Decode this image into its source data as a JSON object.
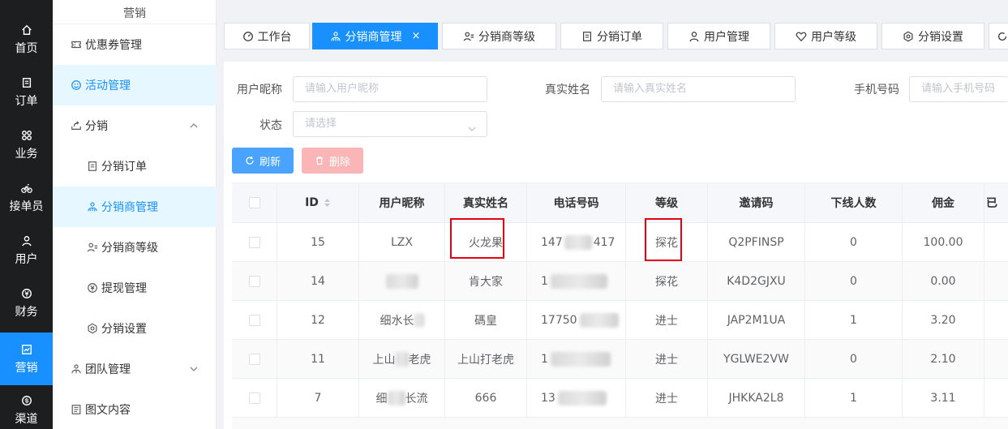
{
  "rail": {
    "items": [
      {
        "label": "首页",
        "icon": "home-icon"
      },
      {
        "label": "订单",
        "icon": "order-icon"
      },
      {
        "label": "业务",
        "icon": "business-icon"
      },
      {
        "label": "接单员",
        "icon": "bike-icon"
      },
      {
        "label": "用户",
        "icon": "user-icon"
      },
      {
        "label": "财务",
        "icon": "finance-icon"
      },
      {
        "label": "营销",
        "icon": "marketing-icon"
      },
      {
        "label": "渠道",
        "icon": "channel-icon"
      }
    ],
    "active_index": 6,
    "accent": "#1890ff"
  },
  "submenu": {
    "header": "营销",
    "items": [
      {
        "label": "优惠券管理",
        "icon": "coupon-icon"
      },
      {
        "label": "活动管理",
        "icon": "smile-icon"
      },
      {
        "label": "分销",
        "icon": "share-icon"
      },
      {
        "label": "分销订单",
        "icon": "document-icon"
      },
      {
        "label": "分销商管理",
        "icon": "distributor-icon"
      },
      {
        "label": "分销商等级",
        "icon": "user-list-icon"
      },
      {
        "label": "提现管理",
        "icon": "withdraw-icon"
      },
      {
        "label": "分销设置",
        "icon": "settings-icon"
      },
      {
        "label": "团队管理",
        "icon": "team-icon"
      },
      {
        "label": "图文内容",
        "icon": "article-icon"
      }
    ]
  },
  "tabs": [
    {
      "label": "工作台",
      "icon": "dashboard-icon"
    },
    {
      "label": "分销商管理",
      "icon": "distributor-icon",
      "close": "×"
    },
    {
      "label": "分销商等级",
      "icon": "user-list-icon"
    },
    {
      "label": "分销订单",
      "icon": "document-icon"
    },
    {
      "label": "用户管理",
      "icon": "user-icon"
    },
    {
      "label": "用户等级",
      "icon": "heart-icon"
    },
    {
      "label": "分销设置",
      "icon": "settings-icon"
    }
  ],
  "filters": {
    "nickname_label": "用户昵称",
    "nickname_placeholder": "请输入用户昵称",
    "realname_label": "真实姓名",
    "realname_placeholder": "请输入真实姓名",
    "phone_label": "手机号码",
    "phone_placeholder": "请输入手机号码",
    "status_label": "状态",
    "status_placeholder": "请选择"
  },
  "actions": {
    "refresh": "刷新",
    "delete": "删除"
  },
  "table": {
    "headers": [
      "ID",
      "用户昵称",
      "真实姓名",
      "电话号码",
      "等级",
      "邀请码",
      "下线人数",
      "佣金",
      "已"
    ],
    "rows": [
      {
        "id": "15",
        "nickname": "LZX",
        "realname": "火龙果",
        "phone": "147",
        "phone_tail": "417",
        "level": "探花",
        "code": "Q2PFINSP",
        "downline": "0",
        "commission": "100.00"
      },
      {
        "id": "14",
        "nickname": "",
        "realname": "肯大家",
        "phone": "1",
        "phone_tail": "",
        "level": "探花",
        "code": "K4D2GJXU",
        "downline": "0",
        "commission": "0.00"
      },
      {
        "id": "12",
        "nickname": "细水长",
        "realname": "碼皇",
        "phone": "17750",
        "phone_tail": "",
        "level": "进士",
        "code": "JAP2M1UA",
        "downline": "1",
        "commission": "3.20"
      },
      {
        "id": "11",
        "nickname": "上山",
        "nickname_tail": "老虎",
        "realname": "上山打老虎",
        "phone": "1",
        "phone_tail": "",
        "level": "进士",
        "code": "YGLWE2VW",
        "downline": "0",
        "commission": "2.10"
      },
      {
        "id": "7",
        "nickname": "细",
        "nickname_tail": "长流",
        "realname": "666",
        "phone": "13",
        "phone_tail": "",
        "level": "进士",
        "code": "JHKKA2L8",
        "downline": "1",
        "commission": "3.11"
      }
    ]
  }
}
